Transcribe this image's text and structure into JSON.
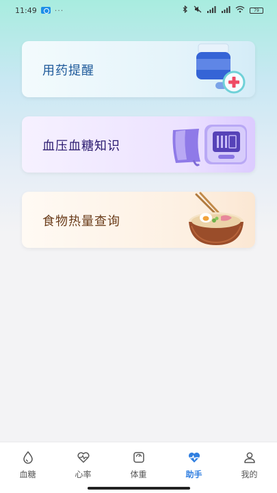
{
  "status_bar": {
    "time": "11:49",
    "more_indicator": "···",
    "battery": "79"
  },
  "cards": [
    {
      "label": "用药提醒",
      "icon": "medicine-bottle-icon"
    },
    {
      "label": "血压血糖知识",
      "icon": "blood-pressure-monitor-icon"
    },
    {
      "label": "食物热量查询",
      "icon": "noodle-bowl-icon"
    }
  ],
  "tabbar": {
    "items": [
      {
        "label": "血糖",
        "icon": "blood-drop-icon",
        "active": false
      },
      {
        "label": "心率",
        "icon": "heart-rate-icon",
        "active": false
      },
      {
        "label": "体重",
        "icon": "scale-icon",
        "active": false
      },
      {
        "label": "助手",
        "icon": "assistant-heart-icon",
        "active": true
      },
      {
        "label": "我的",
        "icon": "user-icon",
        "active": false
      }
    ]
  },
  "colors": {
    "active_tab": "#2f7ee0",
    "card1_text": "#1f5a9a",
    "card2_text": "#2a1a6e",
    "card3_text": "#6a3c1a"
  }
}
